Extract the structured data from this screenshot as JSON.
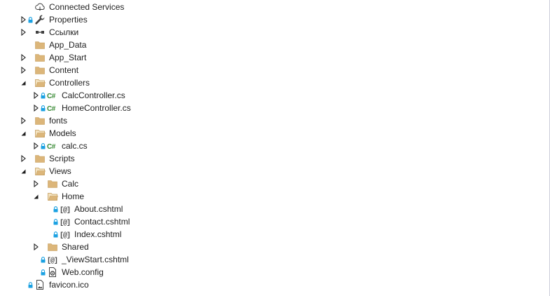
{
  "solution_explorer": {
    "items": [
      {
        "label": "Connected Services",
        "icon": "connected-services-icon",
        "expander": "none",
        "locked": false,
        "depth": 1
      },
      {
        "label": "Properties",
        "icon": "wrench-icon",
        "expander": "collapsed",
        "locked": true,
        "depth": 1
      },
      {
        "label": "Ссылки",
        "icon": "references-icon",
        "expander": "collapsed",
        "locked": false,
        "depth": 1
      },
      {
        "label": "App_Data",
        "icon": "folder-icon",
        "expander": "none",
        "locked": false,
        "depth": 1
      },
      {
        "label": "App_Start",
        "icon": "folder-icon",
        "expander": "collapsed",
        "locked": false,
        "depth": 1
      },
      {
        "label": "Content",
        "icon": "folder-icon",
        "expander": "collapsed",
        "locked": false,
        "depth": 1
      },
      {
        "label": "Controllers",
        "icon": "folder-open-icon",
        "expander": "expanded",
        "locked": false,
        "depth": 1
      },
      {
        "label": "CalcController.cs",
        "icon": "csharp-file-icon",
        "expander": "collapsed",
        "locked": true,
        "depth": 2
      },
      {
        "label": "HomeController.cs",
        "icon": "csharp-file-icon",
        "expander": "collapsed",
        "locked": true,
        "depth": 2
      },
      {
        "label": "fonts",
        "icon": "folder-icon",
        "expander": "collapsed",
        "locked": false,
        "depth": 1
      },
      {
        "label": "Models",
        "icon": "folder-open-icon",
        "expander": "expanded",
        "locked": false,
        "depth": 1
      },
      {
        "label": "calc.cs",
        "icon": "csharp-file-icon",
        "expander": "collapsed",
        "locked": true,
        "depth": 2
      },
      {
        "label": "Scripts",
        "icon": "folder-icon",
        "expander": "collapsed",
        "locked": false,
        "depth": 1
      },
      {
        "label": "Views",
        "icon": "folder-open-icon",
        "expander": "expanded",
        "locked": false,
        "depth": 1
      },
      {
        "label": "Calc",
        "icon": "folder-icon",
        "expander": "collapsed",
        "locked": false,
        "depth": 2
      },
      {
        "label": "Home",
        "icon": "folder-open-icon",
        "expander": "expanded",
        "locked": false,
        "depth": 2
      },
      {
        "label": "About.cshtml",
        "icon": "razor-file-icon",
        "expander": "none",
        "locked": true,
        "depth": 3
      },
      {
        "label": "Contact.cshtml",
        "icon": "razor-file-icon",
        "expander": "none",
        "locked": true,
        "depth": 3
      },
      {
        "label": "Index.cshtml",
        "icon": "razor-file-icon",
        "expander": "none",
        "locked": true,
        "depth": 3
      },
      {
        "label": "Shared",
        "icon": "folder-icon",
        "expander": "collapsed",
        "locked": false,
        "depth": 2
      },
      {
        "label": "_ViewStart.cshtml",
        "icon": "razor-file-icon",
        "expander": "none",
        "locked": true,
        "depth": 2
      },
      {
        "label": "Web.config",
        "icon": "config-file-icon",
        "expander": "none",
        "locked": true,
        "depth": 2
      },
      {
        "label": "favicon.ico",
        "icon": "image-file-icon",
        "expander": "none",
        "locked": true,
        "depth": 1
      }
    ]
  },
  "colors": {
    "folder": "#dcb67a",
    "csharp": "#388a34",
    "lock": "#1ba1e2",
    "text": "#1e1e1e",
    "arrow": "#1e1e1e"
  }
}
